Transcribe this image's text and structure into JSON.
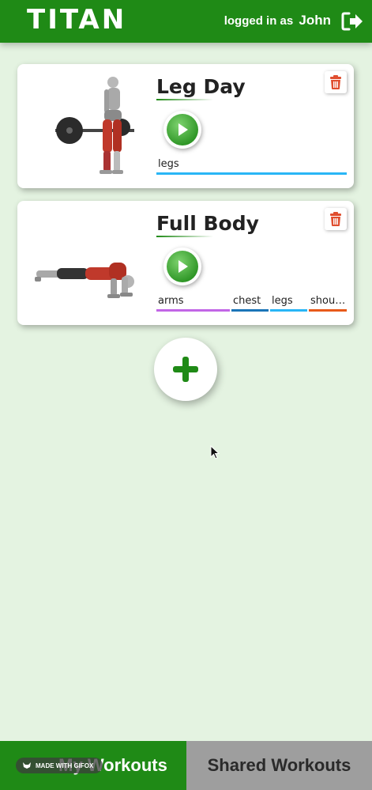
{
  "header": {
    "logo": "TITAN",
    "login_prefix": "logged in as",
    "username": "John",
    "logout_icon": "sign-out-icon"
  },
  "workouts": [
    {
      "title": "Leg Day",
      "image": "deadlift-illustration",
      "tags": [
        {
          "label": "legs",
          "color": "#29b6f6"
        }
      ]
    },
    {
      "title": "Full Body",
      "image": "pushup-illustration",
      "tags": [
        {
          "label": "arms",
          "color": "#c266e6"
        },
        {
          "label": "chest",
          "color": "#1b75b8"
        },
        {
          "label": "legs",
          "color": "#29b6f6"
        },
        {
          "label": "shoul…",
          "color": "#e85a1a"
        }
      ]
    }
  ],
  "add_button_icon": "plus-icon",
  "nav": {
    "my_workouts": "My Workouts",
    "shared_workouts": "Shared Workouts"
  },
  "watermark": "MADE WITH GIFOX",
  "colors": {
    "brand_green": "#1f8a16",
    "background": "#e4f3e1",
    "delete_red": "#e04e2f"
  }
}
